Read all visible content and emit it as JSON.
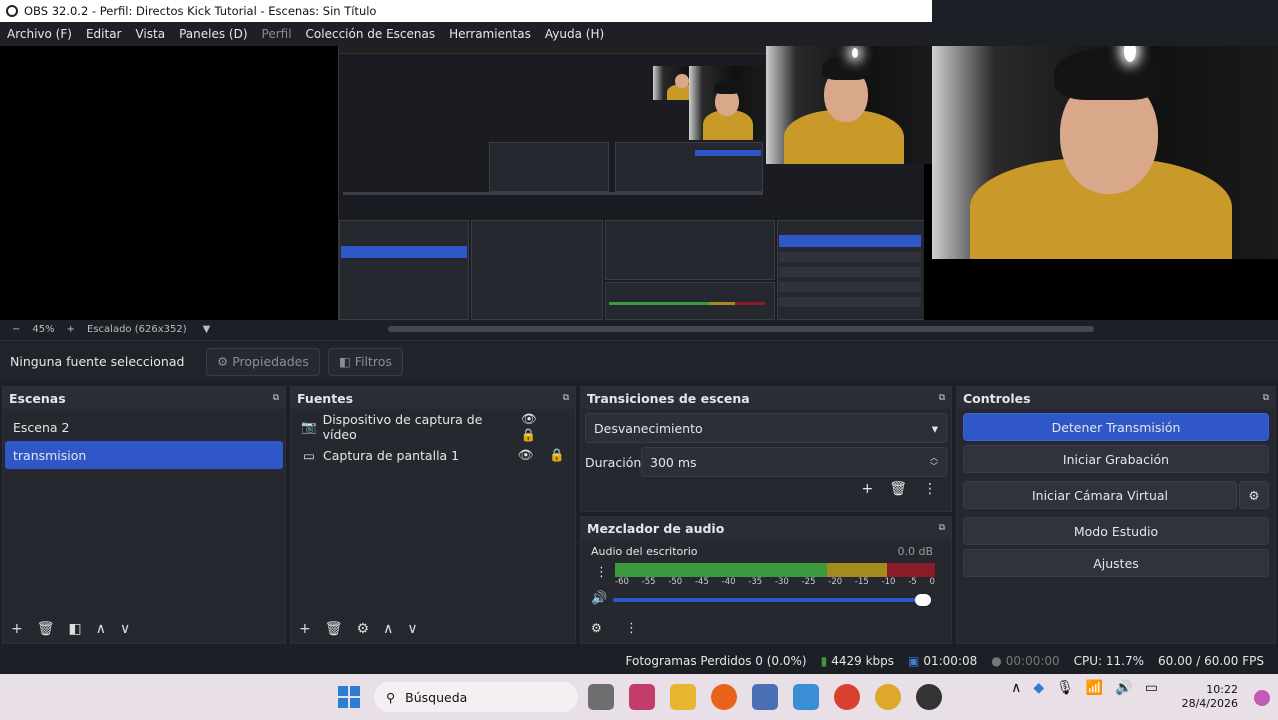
{
  "window": {
    "title": "OBS 32.0.2 - Perfil: Directos Kick Tutorial - Escenas: Sin Título"
  },
  "menu": [
    "Archivo (F)",
    "Editar",
    "Vista",
    "Paneles (D)",
    "Perfil",
    "Colección de Escenas",
    "Herramientas",
    "Ayuda (H)"
  ],
  "zoom": {
    "minus": "−",
    "value": "45%",
    "plus": "+",
    "scaled": "Escalado (626x352)"
  },
  "source_bar": {
    "label": "Ninguna fuente seleccionad",
    "properties": "Propiedades",
    "filters": "Filtros"
  },
  "scenes": {
    "title": "Escenas",
    "items": [
      "Escena 2",
      "transmision"
    ],
    "selected": 1
  },
  "sources": {
    "title": "Fuentes",
    "items": [
      "Dispositivo de captura de vídeo",
      "Captura de pantalla 1"
    ]
  },
  "transitions": {
    "title": "Transiciones de escena",
    "selected": "Desvanecimiento",
    "duration_label": "Duración",
    "duration_value": "300 ms"
  },
  "mixer": {
    "title": "Mezclador de audio",
    "channel": "Audio del escritorio",
    "level": "0.0 dB",
    "ticks": [
      "-60",
      "-55",
      "-50",
      "-45",
      "-40",
      "-35",
      "-30",
      "-25",
      "-20",
      "-15",
      "-10",
      "-5",
      "0"
    ]
  },
  "controls": {
    "title": "Controles",
    "stop_stream": "Detener Transmisión",
    "start_record": "Iniciar Grabación",
    "virtual_cam": "Iniciar Cámara Virtual",
    "studio_mode": "Modo Estudio",
    "settings": "Ajustes"
  },
  "status": {
    "dropped": "Fotogramas Perdidos 0 (0.0%)",
    "bitrate": "4429 kbps",
    "live_time": "01:00:08",
    "rec_time": "00:00:00",
    "cpu": "CPU: 11.7%",
    "fps": "60.00 / 60.00 FPS"
  },
  "taskbar": {
    "search_placeholder": "Búsqueda",
    "time": "10:22",
    "date": "28/4/2026"
  },
  "colors": {
    "accent": "#2f57c8",
    "meter_green": "#3c9a3e",
    "meter_yellow": "#a58a1e",
    "meter_red": "#8a1c2a"
  },
  "icons": [
    "obs-icon",
    "gear-icon",
    "filter-icon",
    "eye-icon",
    "lock-icon",
    "camera-icon",
    "monitor-icon",
    "plus-icon",
    "trash-icon",
    "up-icon",
    "down-icon",
    "speaker-icon",
    "kebab-icon",
    "float-icon",
    "windows-icon",
    "search-icon"
  ]
}
